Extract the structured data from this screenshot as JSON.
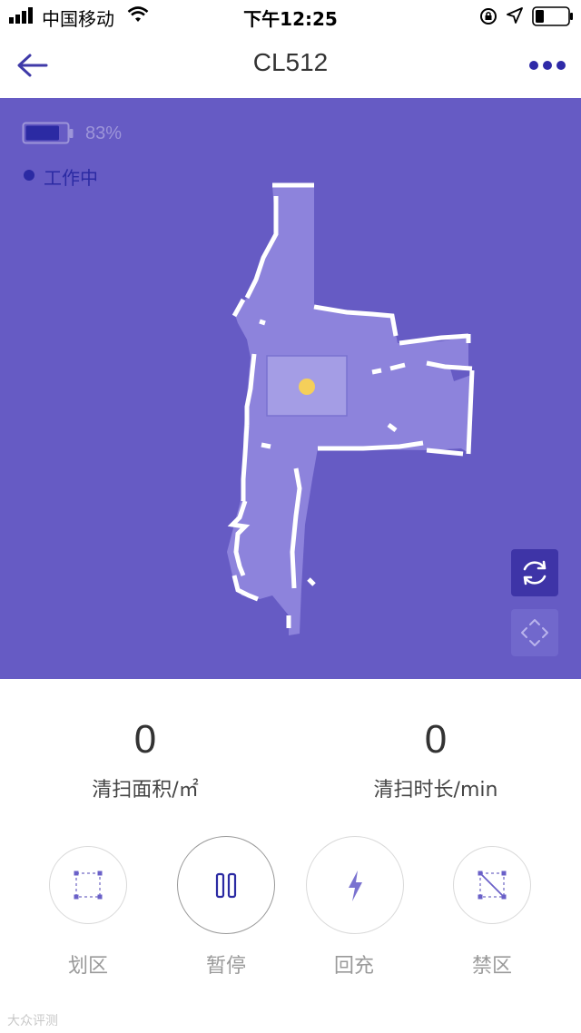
{
  "status_bar": {
    "carrier": "中国移动",
    "time": "下午12:25"
  },
  "nav": {
    "title": "CL512",
    "back_icon": "arrow-left-icon",
    "more_icon": "more-dots-icon"
  },
  "map": {
    "background": "#665bc4",
    "battery_percent": "83%",
    "battery_level": 0.83,
    "work_status": "工作中",
    "refresh_icon": "refresh-icon",
    "recenter_icon": "recenter-icon"
  },
  "stats": {
    "area_value": "0",
    "area_label": "清扫面积/㎡",
    "time_value": "0",
    "time_label": "清扫时长/min"
  },
  "actions": [
    {
      "label": "划区",
      "icon": "zone-select-icon"
    },
    {
      "label": "暂停",
      "icon": "pause-icon"
    },
    {
      "label": "回充",
      "icon": "recharge-icon"
    },
    {
      "label": "禁区",
      "icon": "no-go-zone-icon"
    }
  ],
  "watermark": "大众评测"
}
